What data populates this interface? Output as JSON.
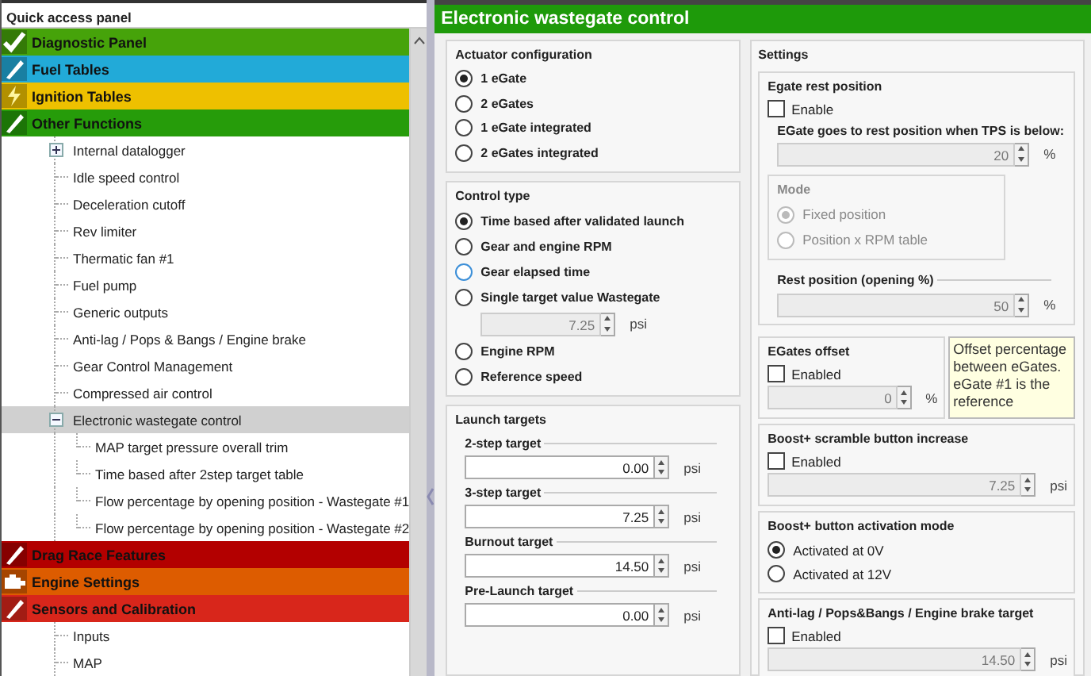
{
  "quick_access_panel": {
    "title": "Quick access panel",
    "categories": [
      {
        "label": "Diagnostic Panel",
        "color": "#46a30a"
      },
      {
        "label": "Fuel Tables",
        "color": "#22aad8"
      },
      {
        "label": "Ignition Tables",
        "color": "#eec000"
      },
      {
        "label": "Other Functions",
        "color": "#269c0a",
        "children": [
          {
            "label": "Internal datalogger",
            "kind": "group",
            "expanded": false,
            "selected": false
          },
          {
            "label": "Idle speed control",
            "kind": "leaf",
            "selected": false
          },
          {
            "label": "Deceleration cutoff",
            "kind": "leaf",
            "selected": false
          },
          {
            "label": "Rev limiter",
            "kind": "leaf",
            "selected": false
          },
          {
            "label": "Thermatic fan #1",
            "kind": "leaf",
            "selected": false
          },
          {
            "label": "Fuel pump",
            "kind": "leaf",
            "selected": false
          },
          {
            "label": "Generic outputs",
            "kind": "leaf",
            "selected": false
          },
          {
            "label": "Anti-lag / Pops & Bangs / Engine brake",
            "kind": "leaf",
            "selected": false
          },
          {
            "label": "Gear Control Management",
            "kind": "leaf",
            "selected": false
          },
          {
            "label": "Compressed air control",
            "kind": "leaf",
            "selected": false
          },
          {
            "label": "Electronic wastegate control",
            "kind": "group",
            "expanded": true,
            "selected": true,
            "children": [
              {
                "label": "MAP target pressure overall trim",
                "kind": "leaf",
                "selected": false
              },
              {
                "label": "Time based after 2step target table",
                "kind": "leaf",
                "selected": false
              },
              {
                "label": "Flow percentage by opening position - Wastegate #1",
                "kind": "leaf",
                "selected": false
              },
              {
                "label": "Flow percentage by opening position - Wastegate #2",
                "kind": "leaf",
                "selected": false
              }
            ]
          }
        ]
      },
      {
        "label": "Drag Race Features",
        "color": "#b30000"
      },
      {
        "label": "Engine Settings",
        "color": "#dd5c00"
      },
      {
        "label": "Sensors and Calibration",
        "color": "#d8261b",
        "children": [
          {
            "label": "Inputs",
            "kind": "leaf",
            "selected": false
          },
          {
            "label": "MAP",
            "kind": "leaf",
            "selected": false
          }
        ]
      }
    ]
  },
  "page": {
    "title": "Electronic wastegate control",
    "actuator_configuration": {
      "title": "Actuator configuration",
      "options": [
        {
          "label": "1 eGate",
          "selected": true
        },
        {
          "label": "2 eGates",
          "selected": false
        },
        {
          "label": "1 eGate integrated",
          "selected": false
        },
        {
          "label": "2 eGates integrated",
          "selected": false
        }
      ]
    },
    "control_type": {
      "title": "Control type",
      "options": [
        {
          "label": "Time based after validated launch",
          "selected": true,
          "hovered": false
        },
        {
          "label": "Gear and engine RPM",
          "selected": false,
          "hovered": false
        },
        {
          "label": "Gear elapsed time",
          "selected": false,
          "hovered": true
        },
        {
          "label": "Single target value Wastegate",
          "selected": false,
          "hovered": false,
          "field": {
            "value": "7.25",
            "unit": "psi"
          }
        },
        {
          "label": "Engine RPM",
          "selected": false,
          "hovered": false
        },
        {
          "label": "Reference speed",
          "selected": false,
          "hovered": false
        }
      ]
    },
    "launch_targets": {
      "title": "Launch targets",
      "fields": [
        {
          "label": "2-step target",
          "value": "0.00",
          "unit": "psi"
        },
        {
          "label": "3-step target",
          "value": "7.25",
          "unit": "psi"
        },
        {
          "label": "Burnout target",
          "value": "14.50",
          "unit": "psi"
        },
        {
          "label": "Pre-Launch target",
          "value": "0.00",
          "unit": "psi"
        }
      ]
    },
    "settings": {
      "title": "Settings",
      "rest_position": {
        "title": "Egate rest position",
        "enable": {
          "label": "Enable",
          "checked": false
        },
        "tps_label": "EGate goes to rest position when TPS is below:",
        "tps": {
          "value": "20",
          "unit": "%"
        },
        "mode": {
          "title": "Mode",
          "options": [
            {
              "label": "Fixed position",
              "selected": true
            },
            {
              "label": "Position x RPM table",
              "selected": false
            }
          ]
        },
        "rest_label": "Rest position (opening %)",
        "rest": {
          "value": "50",
          "unit": "%"
        }
      },
      "offset": {
        "title": "EGates offset",
        "enable": {
          "label": "Enabled",
          "checked": false
        },
        "field": {
          "value": "0",
          "unit": "%"
        },
        "note": "Offset percentage between eGates. eGate #1 is the reference"
      },
      "scramble": {
        "title": "Boost+ scramble button increase",
        "enable": {
          "label": "Enabled",
          "checked": false
        },
        "field": {
          "value": "7.25",
          "unit": "psi"
        }
      },
      "activation": {
        "title": "Boost+ button activation mode",
        "options": [
          {
            "label": "Activated at 0V",
            "selected": true
          },
          {
            "label": "Activated at 12V",
            "selected": false
          }
        ]
      },
      "antilag": {
        "title": "Anti-lag / Pops&Bangs / Engine brake target",
        "enable": {
          "label": "Enabled",
          "checked": false
        },
        "field": {
          "value": "14.50",
          "unit": "psi"
        }
      }
    }
  }
}
